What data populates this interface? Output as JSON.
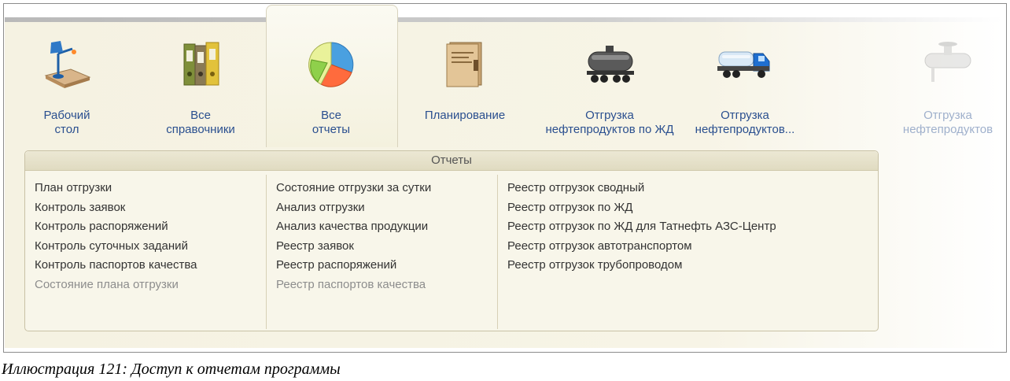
{
  "sections": [
    {
      "id": "desktop",
      "label_line1": "Рабочий",
      "label_line2": "стол",
      "icon": "desk-lamp-icon"
    },
    {
      "id": "directories",
      "label_line1": "Все",
      "label_line2": "справочники",
      "icon": "binders-icon"
    },
    {
      "id": "reports",
      "label_line1": "Все",
      "label_line2": "отчеты",
      "icon": "pie-chart-icon",
      "active": true
    },
    {
      "id": "planning",
      "label_line1": "Планирование",
      "label_line2": "",
      "icon": "folder-icon"
    },
    {
      "id": "rail",
      "label_line1": "Отгрузка",
      "label_line2": "нефтепродуктов по ЖД",
      "icon": "tank-car-icon"
    },
    {
      "id": "auto",
      "label_line1": "Отгрузка",
      "label_line2": "нефтепродуктов...",
      "icon": "tanker-truck-icon"
    },
    {
      "id": "pipe",
      "label_line1": "Отгрузка",
      "label_line2": "нефтепродуктов",
      "icon": "pipe-valve-icon",
      "faded": true
    }
  ],
  "reports": {
    "header": "Отчеты",
    "columns": [
      [
        {
          "label": "План отгрузки"
        },
        {
          "label": "Контроль заявок"
        },
        {
          "label": "Контроль распоряжений"
        },
        {
          "label": "Контроль суточных заданий"
        },
        {
          "label": "Контроль паспортов качества"
        },
        {
          "label": "Состояние плана отгрузки",
          "disabled": true
        }
      ],
      [
        {
          "label": "Состояние отгрузки за сутки"
        },
        {
          "label": "Анализ отгрузки"
        },
        {
          "label": "Анализ качества продукции"
        },
        {
          "label": "Реестр заявок"
        },
        {
          "label": "Реестр распоряжений"
        },
        {
          "label": "Реестр паспортов качества",
          "disabled": true
        }
      ],
      [
        {
          "label": "Реестр отгрузок сводный"
        },
        {
          "label": "Реестр отгрузок по ЖД"
        },
        {
          "label": "Реестр отгрузок по ЖД для Татнефть АЗС-Центр"
        },
        {
          "label": "Реестр отгрузок автотранспортом"
        },
        {
          "label": "Реестр отгрузок трубопроводом"
        }
      ]
    ]
  },
  "caption": "Иллюстрация 121: Доступ к отчетам программы",
  "colors": {
    "link": "#2a4f8f",
    "panel": "#f7f4e6",
    "disabled": "#8d8d8d"
  }
}
